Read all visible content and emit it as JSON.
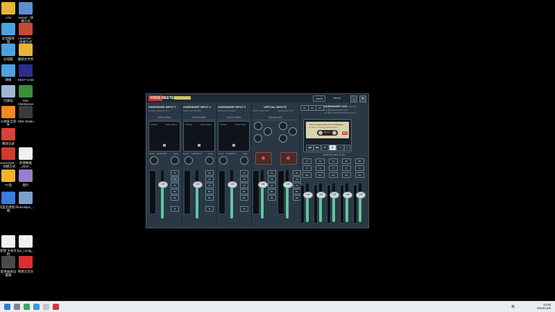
{
  "desktop_icons": [
    {
      "name": "folder-icon",
      "label": "c-ho",
      "color": "#e8b33a"
    },
    {
      "name": "app-icon",
      "label": "veeam - 快\n捷方式",
      "color": "#5b8fd1"
    },
    {
      "name": "computer-icon",
      "label": "此电脑管\n理",
      "color": "#4aa3e0"
    },
    {
      "name": "launcher-icon",
      "label": "Launcher -\n快捷方式",
      "color": "#c44a3a"
    },
    {
      "name": "monitor-icon",
      "label": "此电脑",
      "color": "#4aa3e0"
    },
    {
      "name": "folder-icon",
      "label": "截图文件夹",
      "color": "#e8b33a"
    },
    {
      "name": "network-icon",
      "label": "网络",
      "color": "#4aa3e0"
    },
    {
      "name": "next-icon",
      "label": "NEXT CAM",
      "color": "#2b2f8a"
    },
    {
      "name": "recycle-icon",
      "label": "回收站",
      "color": "#9fb7d0"
    },
    {
      "name": "msi-icon",
      "label": "MSI\nAfterBurner",
      "color": "#3a8f3a"
    },
    {
      "name": "shop-icon",
      "label": "火绒安全软\n件",
      "color": "#f08a24"
    },
    {
      "name": "obs-icon",
      "label": "OBS Studio",
      "color": "#3a3a3a"
    },
    {
      "name": "flag-icon",
      "label": "播放记录",
      "color": "#d9423a"
    },
    {
      "name": "voicemeeter-icon",
      "label": "voicemeet...\n- 快捷方式",
      "color": "#d23a2e"
    },
    {
      "name": "file-icon",
      "label": "新建数据\n_2023... ",
      "color": "#f0f0f0"
    },
    {
      "name": "tv-icon",
      "label": "TV盒",
      "color": "#f0b429"
    },
    {
      "name": "image-icon",
      "label": "图片",
      "color": "#9b7dd1"
    },
    {
      "name": "cloud-icon",
      "label": "阿里云盘客户\n端",
      "color": "#3a7be0"
    },
    {
      "name": "zip-icon",
      "label": "unlocktips_...",
      "color": "#7aa0c8"
    },
    {
      "name": "text-icon",
      "label": "新建 文本文\n档",
      "color": "#f0f0f0"
    },
    {
      "name": "config-icon",
      "label": "fps_config...",
      "color": "#f0f0f0"
    },
    {
      "name": "eye-icon",
      "label": "超清画质设\n置器",
      "color": "#4a4a4a"
    },
    {
      "name": "music-icon",
      "label": "网易云音乐",
      "color": "#d9302c"
    }
  ],
  "voicemeeter": {
    "brand_voice": "VOICE",
    "brand_meeter": "MEETER",
    "vban_label": "VBAN",
    "menu_label": "Menu",
    "minimize": "_",
    "close": "✕",
    "hardware_inputs": [
      {
        "title": "HARDWARE INPUT 1",
        "sub": "Headset Microphone (...)",
        "display_left": "VOICE",
        "display_right": "Color Panel",
        "knob_left": "Comp.",
        "knob_right": "Gate",
        "intellipan": "INTELLIPAN",
        "subtitle": "SUBSHIFT",
        "fader_value": "0dB",
        "fader_label": "Fader Gain"
      },
      {
        "title": "HARDWARE INPUT 2",
        "sub": "Select Input Device",
        "display_left": "VOICE",
        "display_right": "Color Panel",
        "knob_left": "Comp.",
        "knob_right": "Gate",
        "intellipan": "INTELLIPAN",
        "subtitle": "SUBSHIFT",
        "fader_value": "0dB",
        "fader_label": "Fader Gain"
      },
      {
        "title": "HARDWARE INPUT 3",
        "sub": "Select Input Device",
        "display_left": "VOICE",
        "display_right": "Color Panel",
        "knob_left": "Comp.",
        "knob_right": "Gate",
        "intellipan": "INTELLIPAN",
        "subtitle": "SUBSHIFT",
        "fader_value": "0dB",
        "fader_label": "Fader Gain"
      }
    ],
    "virtual_inputs": {
      "title": "VIRTUAL INPUTS",
      "left": "Voicemeeter VAIO",
      "right": "Voicemeeter AUX",
      "eq_label": "EQUALIZER",
      "fader_value": "0dB",
      "fader_label": "Fader Gain"
    },
    "hardware_out": {
      "title": "HARDWARE OUT",
      "rate": "48 kHz | 512",
      "out_a": "A1",
      "out_b": "A2",
      "out_c": "A3",
      "dev_line1": "A1: 耳机 (Realtek(R) Audio)",
      "dev_line2": "A2: DELL P2419H (NVIDIA High Def...)"
    },
    "cassette": {
      "line1": "Click to Select Audio file for Playback",
      "line2": "or click on Record Mode button",
      "time": "00:00",
      "rec_label": "REC"
    },
    "master_section": "MASTER SECTION",
    "master_buses": [
      {
        "label": "A1",
        "fader_value": "0dB"
      },
      {
        "label": "A2",
        "fader_value": "0dB"
      },
      {
        "label": "A3",
        "fader_value": "0dB"
      },
      {
        "label": "B1",
        "fader_value": "0dB"
      },
      {
        "label": "B2",
        "fader_value": "0dB"
      }
    ],
    "bus_buttons": [
      "A1",
      "A2",
      "A3",
      "B1",
      "B2"
    ]
  },
  "taskbar": {
    "time": "10:38",
    "date": "2023/12/5",
    "lang": "英"
  }
}
